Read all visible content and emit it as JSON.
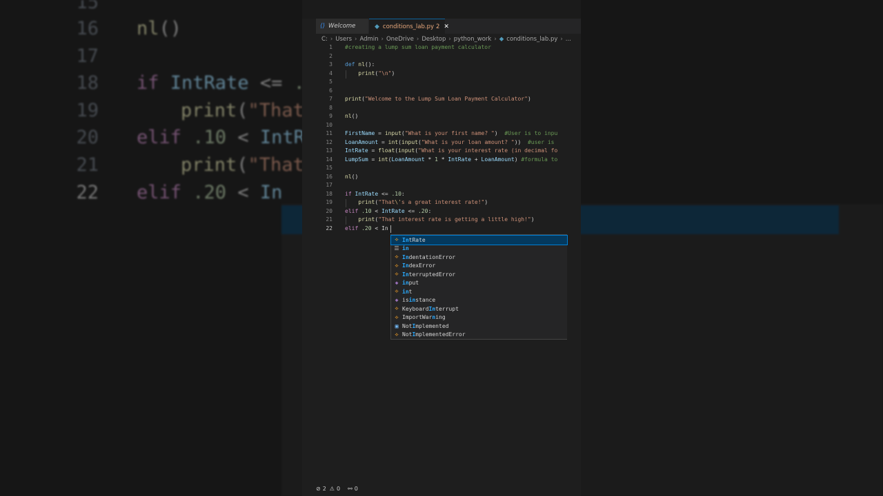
{
  "background": {
    "line_numbers": [
      "15",
      "16",
      "17",
      "18",
      "19",
      "20",
      "21",
      "22"
    ]
  },
  "tabs": [
    {
      "label": "Welcome",
      "icon": "vscode-icon"
    },
    {
      "label": "conditions_lab.py",
      "problems": "2",
      "icon": "python-icon"
    }
  ],
  "breadcrumb": [
    "C:",
    "Users",
    "Admin",
    "OneDrive",
    "Desktop",
    "python_work",
    "conditions_lab.py",
    "..."
  ],
  "code": {
    "line_numbers": [
      "1",
      "2",
      "3",
      "4",
      "5",
      "6",
      "7",
      "8",
      "9",
      "10",
      "11",
      "12",
      "13",
      "14",
      "15",
      "16",
      "17",
      "18",
      "19",
      "20",
      "21",
      "22"
    ],
    "active_line": "22",
    "lines": {
      "l1": "#creating a lump sum loan payment calculator",
      "l3_def": "def",
      "l3_name": "nl",
      "l3_rest": "():",
      "l4_fn": "print",
      "l4_str": "\"\\n\"",
      "l7_fn": "print",
      "l7_str": "\"Welcome to the Lump Sum Loan Payment Calculator\"",
      "l9_fn": "nl",
      "l11_var": "FirstName",
      "l11_fn": "input",
      "l11_str": "\"What is your first name? \"",
      "l11_com": "#User is to inpu",
      "l12_var": "LoanAmount",
      "l12_fn1": "int",
      "l12_fn2": "input",
      "l12_str": "\"What is your loan amount? \"",
      "l12_com": "#user is",
      "l13_var": "IntRate",
      "l13_fn1": "float",
      "l13_fn2": "input",
      "l13_str": "\"What is your interest rate (in decimal fo",
      "l14_var": "LumpSum",
      "l14_fn": "int",
      "l14_a": "LoanAmount",
      "l14_num": "1",
      "l14_b": "IntRate",
      "l14_c": "LoanAmount",
      "l14_com": "#formula to",
      "l16_fn": "nl",
      "l18_kw": "if",
      "l18_var": "IntRate",
      "l18_num": ".10",
      "l19_fn": "print",
      "l19_str_a": "\"That",
      "l19_esc": "\\'",
      "l19_str_b": "s a great interest rate!\"",
      "l20_kw": "elif",
      "l20_num1": ".10",
      "l20_var": "IntRate",
      "l20_num2": ".20",
      "l21_fn": "print",
      "l21_str": "\"That interest rate is getting a little high!\"",
      "l22_kw": "elif",
      "l22_num": ".20",
      "l22_typed": "In"
    }
  },
  "suggestions": [
    {
      "kind": "class",
      "pre": "",
      "hl": "In",
      "post": "tRate",
      "selected": true
    },
    {
      "kind": "keyword",
      "pre": "",
      "hl": "in",
      "post": "",
      "selected": false
    },
    {
      "kind": "class",
      "pre": "",
      "hl": "In",
      "post": "dentationError",
      "selected": false
    },
    {
      "kind": "class",
      "pre": "",
      "hl": "In",
      "post": "dexError",
      "selected": false
    },
    {
      "kind": "class",
      "pre": "",
      "hl": "In",
      "post": "terruptedError",
      "selected": false
    },
    {
      "kind": "function",
      "pre": "",
      "hl": "in",
      "post": "put",
      "selected": false
    },
    {
      "kind": "class",
      "pre": "",
      "hl": "in",
      "post": "t",
      "selected": false
    },
    {
      "kind": "function",
      "pre": "is",
      "hl": "in",
      "post": "stance",
      "selected": false
    },
    {
      "kind": "class",
      "pre": "Keyboard",
      "hl": "In",
      "post": "terrupt",
      "selected": false
    },
    {
      "kind": "class",
      "pre": "ImportWar",
      "hl": "n",
      "post": "ing",
      "selected": false
    },
    {
      "kind": "constant",
      "pre": "Not",
      "hl": "I",
      "post": "mplemented",
      "selected": false
    },
    {
      "kind": "class",
      "pre": "Not",
      "hl": "I",
      "post": "mplementedError",
      "selected": false
    }
  ],
  "status": {
    "errors": "2",
    "warnings": "0",
    "ports": "0"
  }
}
